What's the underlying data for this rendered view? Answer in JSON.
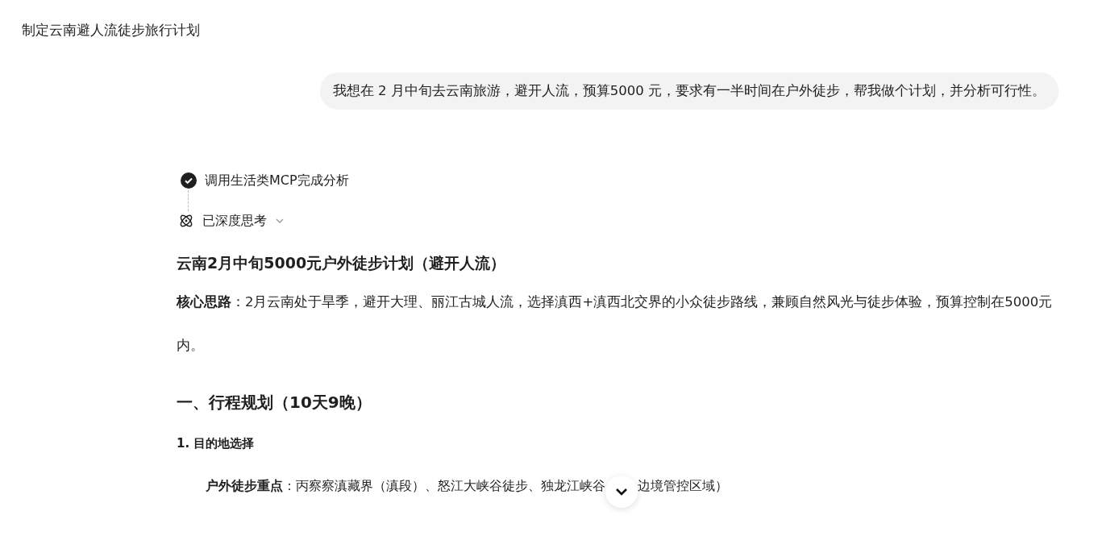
{
  "chat_title": "制定云南避人流徒步旅行计划",
  "user_message": "我想在 2 月中旬去云南旅游，避开人流，预算5000 元，要求有一半时间在户外徒步，帮我做个计划，并分析可行性。",
  "steps": [
    {
      "kind": "done",
      "label": "调用生活类MCP完成分析"
    },
    {
      "kind": "thinking",
      "label": "已深度思考",
      "expanded": false
    }
  ],
  "answer": {
    "title": "云南2月中旬5000元户外徒步计划（避开人流）",
    "summary": "**核心思路**：2月云南处于旱季，避开大理、丽江古城人流，选择滇西+滇西北交界的小众徒步路线，兼顾自然风光与徒步体验，预算控制在5000元内。",
    "section_heading": "一、行程规划（10天9晚）",
    "subheading": "1. 目的地选择",
    "bullet": {
      "label": "户外徒步重点",
      "separator": "：",
      "text_before": "丙察察滇藏界（滇段）、怒江大峡谷徒步、独龙江峡谷",
      "text_after": "边境管控区域）"
    }
  }
}
